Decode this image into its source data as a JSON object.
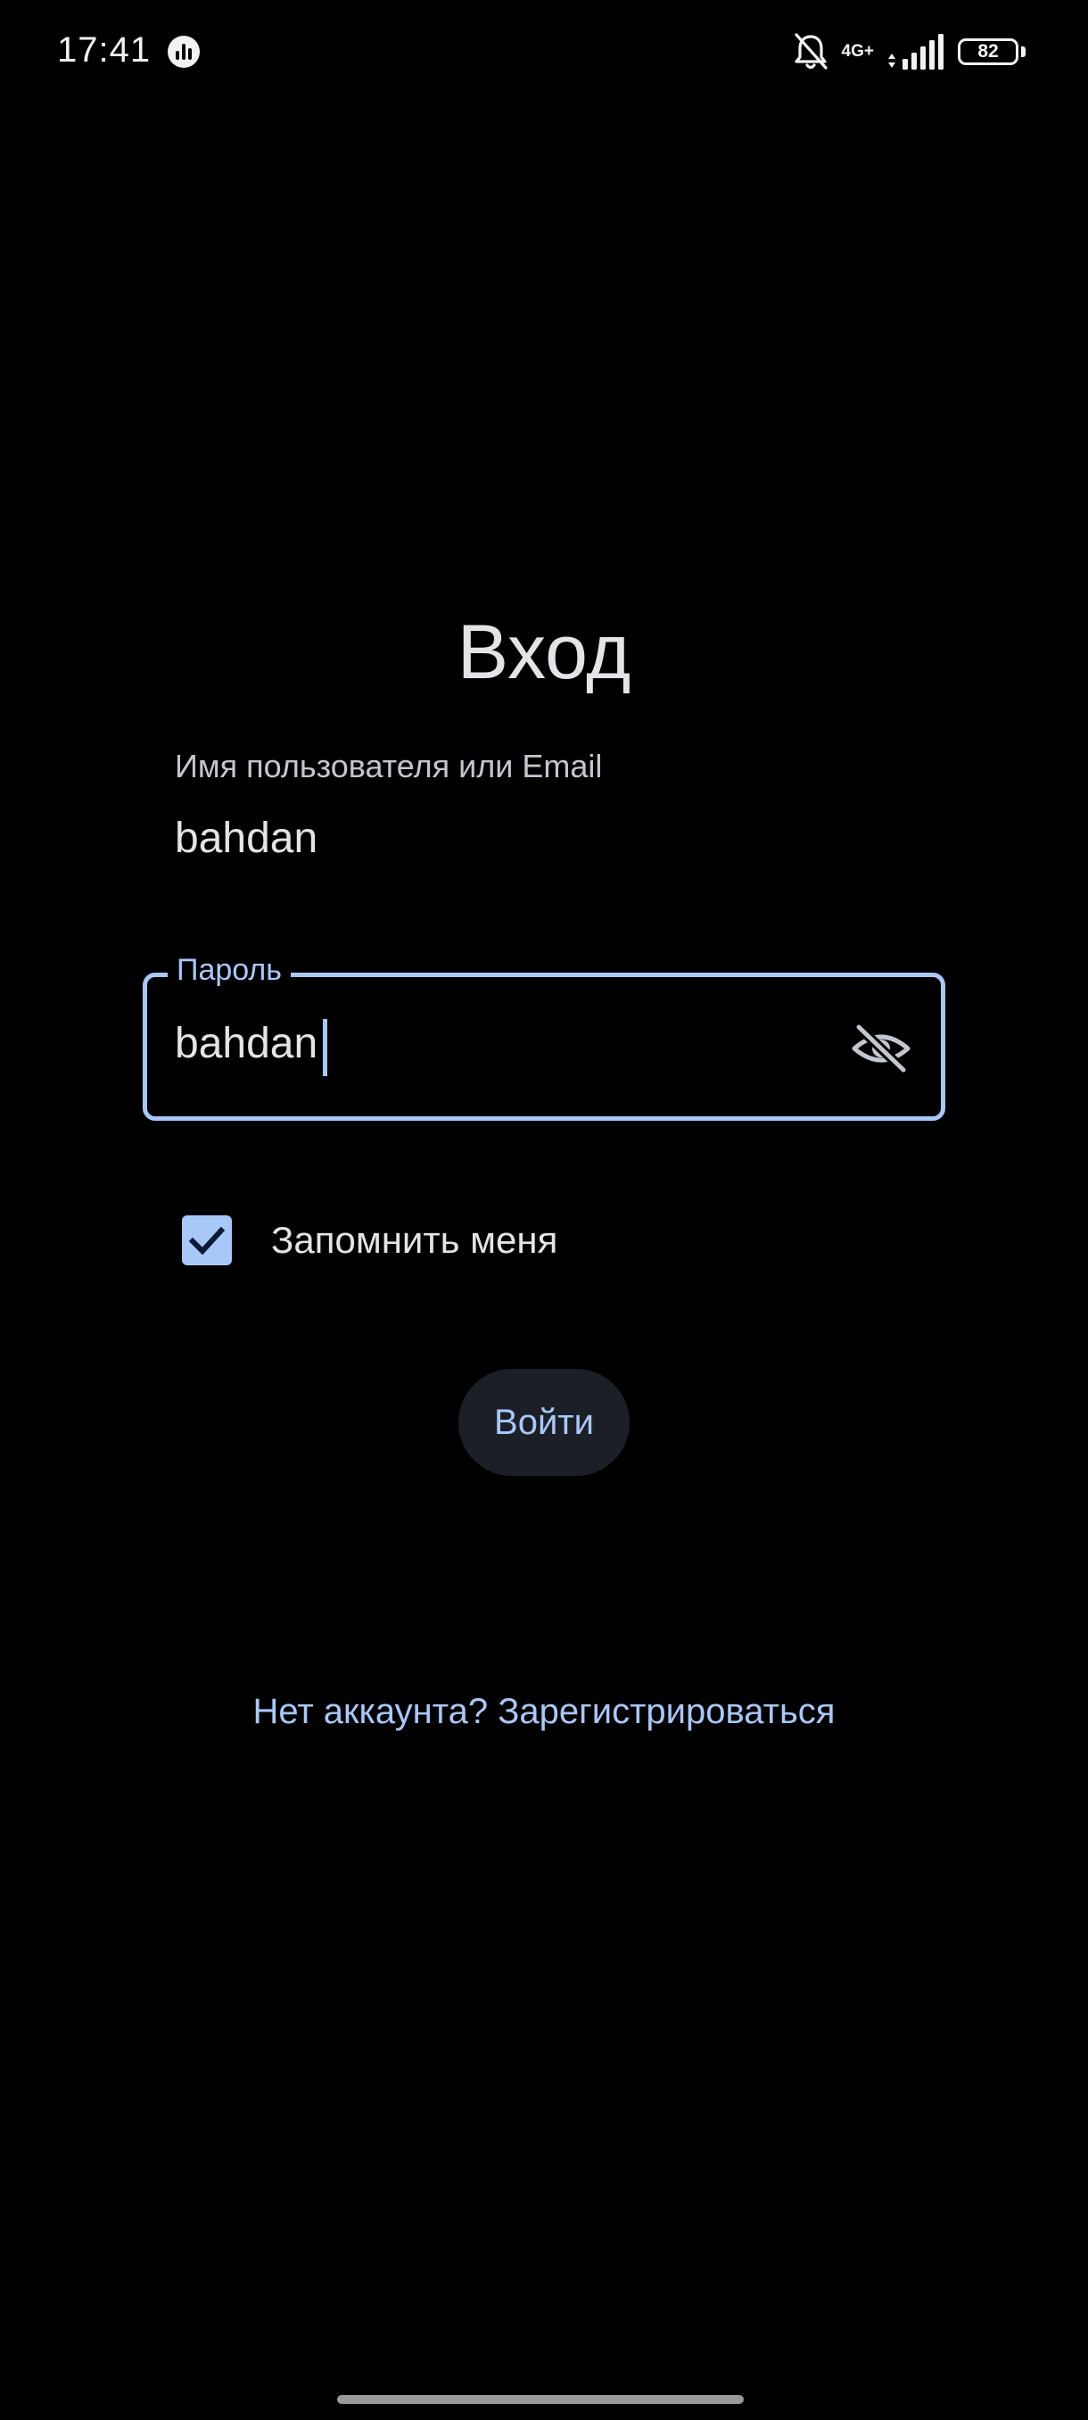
{
  "status_bar": {
    "time": "17:41",
    "app_icon": "analytics-icon",
    "silent_icon": "bell-off-icon",
    "network_line1": "4G+",
    "signal_icon": "signal-bars-icon",
    "battery_level": "82"
  },
  "login": {
    "title": "Вход",
    "username": {
      "label": "Имя пользователя или Email",
      "value": "bahdan"
    },
    "password": {
      "label": "Пароль",
      "value": "bahdan",
      "visibility_icon": "eye-off-icon"
    },
    "remember_me": {
      "label": "Запомнить меня",
      "checked": true
    },
    "submit_label": "Войти",
    "register_link": "Нет аккаунта? Зарегистрироваться"
  },
  "colors": {
    "background": "#000000",
    "accent": "#a8c8fa",
    "text": "#e4e4e8",
    "button_bg": "#1c1f26"
  }
}
